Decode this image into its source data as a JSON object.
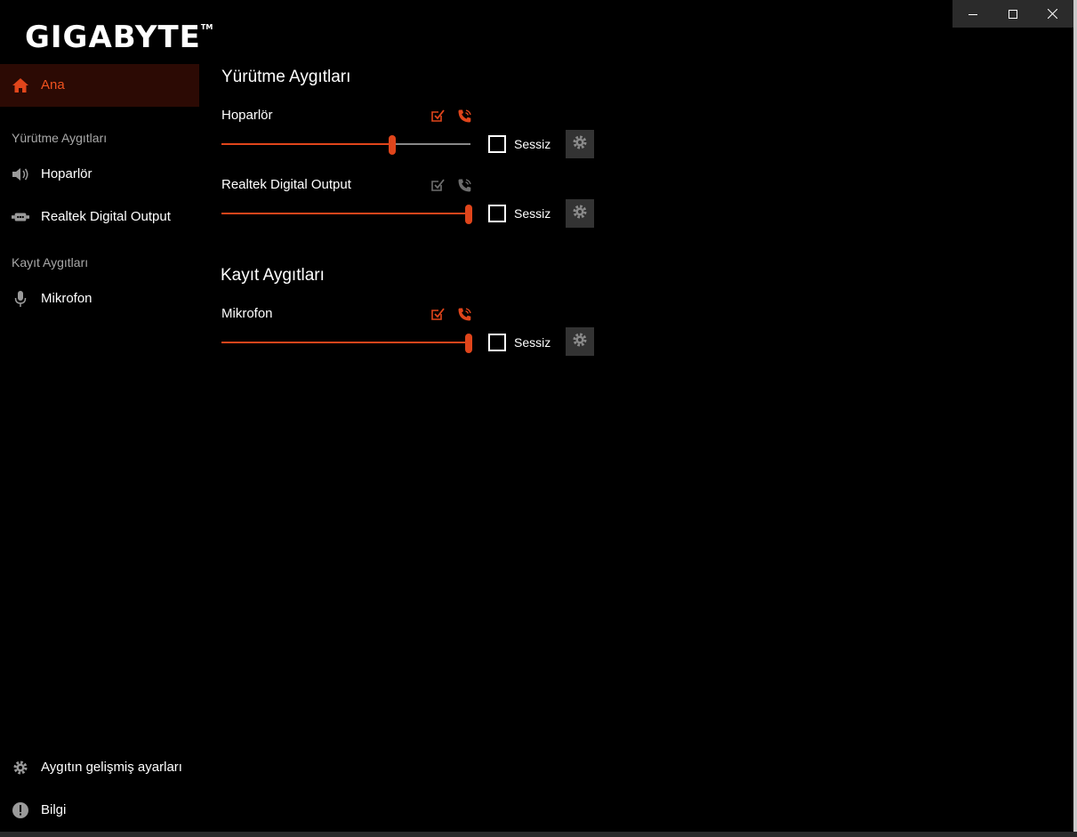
{
  "window": {
    "controls": [
      "minimize-icon",
      "maximize-icon",
      "close-icon"
    ]
  },
  "brand": {
    "logo": "GIGABYTE",
    "tm": "TM"
  },
  "sidebar": {
    "home_label": "Ana",
    "playback_section": "Yürütme Aygıtları",
    "playback_items": [
      {
        "label": "Hoparlör",
        "icon": "speaker-icon"
      },
      {
        "label": "Realtek Digital Output",
        "icon": "digital-output-icon"
      }
    ],
    "recording_section": "Kayıt Aygıtları",
    "recording_items": [
      {
        "label": "Mikrofon",
        "icon": "microphone-icon"
      }
    ],
    "advanced_label": "Aygıtın gelişmiş ayarları",
    "info_label": "Bilgi"
  },
  "main": {
    "playback_title": "Yürütme Aygıtları",
    "recording_title": "Kayıt Aygıtları",
    "mute_label": "Sessiz",
    "devices": [
      {
        "name": "Hoparlör",
        "volume_fraction": 0.69,
        "muted": false,
        "default_active": true,
        "comm_active": true
      },
      {
        "name": "Realtek Digital Output",
        "volume_fraction": 1.0,
        "muted": false,
        "default_active": false,
        "comm_active": false
      },
      {
        "name": "Mikrofon",
        "volume_fraction": 1.0,
        "muted": false,
        "default_active": true,
        "comm_active": true
      }
    ]
  },
  "colors": {
    "accent": "#e0451b",
    "active_bg": "#2c0a04",
    "inactive_icon": "#6e6e6e",
    "section_text": "#a8a8a8",
    "button_bg": "#333333"
  }
}
